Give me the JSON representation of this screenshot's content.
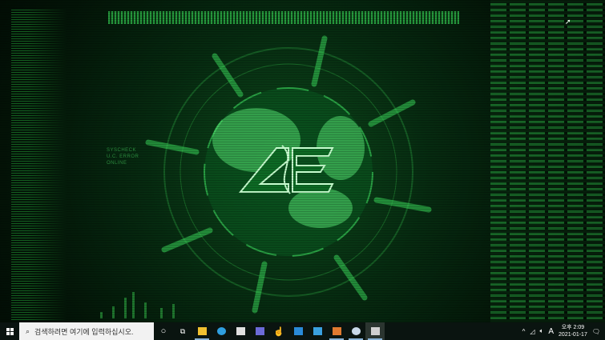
{
  "splash": {
    "logo_text": "AE",
    "side_label": [
      "SYSCHECK",
      "U.C. ERROR",
      "ONLINE"
    ]
  },
  "taskbar": {
    "search_placeholder": "검색하려면 여기에 입력하십시오.",
    "apps": [
      {
        "name": "file-explorer",
        "color": "#f0c030"
      },
      {
        "name": "edge",
        "color": "#2f9fe0"
      },
      {
        "name": "store",
        "color": "#e0e0e0"
      },
      {
        "name": "app-purple",
        "color": "#6c6ad8"
      },
      {
        "name": "hand-app",
        "color": "#ffffff"
      },
      {
        "name": "mail",
        "color": "#2a8ad8"
      },
      {
        "name": "app-blue",
        "color": "#3aa0e0"
      },
      {
        "name": "app-orange",
        "color": "#e07a30"
      },
      {
        "name": "steam",
        "color": "#c8d8e8"
      },
      {
        "name": "game",
        "color": "#d0d0d0"
      }
    ],
    "tray": {
      "ime": "A",
      "time": "오후 2:09",
      "date": "2021-01-17"
    }
  }
}
